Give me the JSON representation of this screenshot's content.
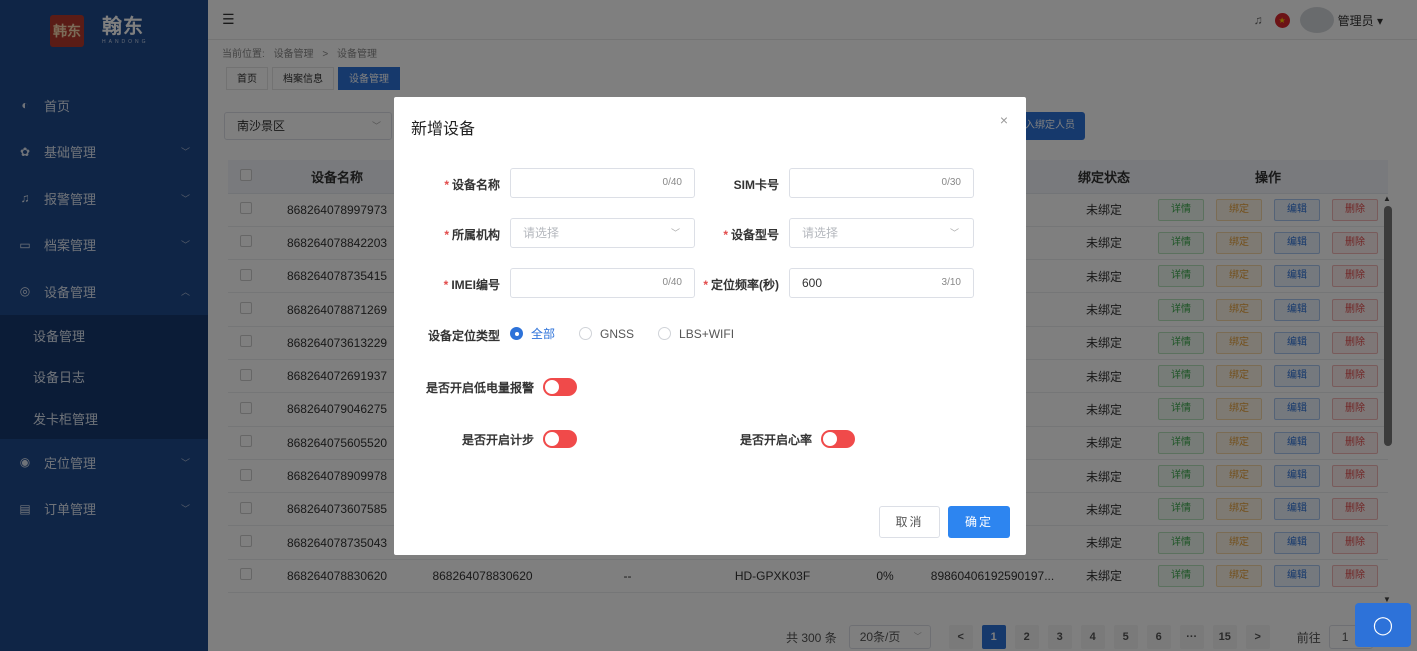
{
  "brand": {
    "logo_char": "韩东",
    "name": "翰东",
    "subtitle": "HANDONG"
  },
  "sidebar": {
    "items": [
      {
        "label": "首页",
        "icon": "dashboard-icon",
        "glyph": "◐",
        "chevron": ""
      },
      {
        "label": "基础管理",
        "icon": "gear-icon",
        "glyph": "✿",
        "chevron": "﹀"
      },
      {
        "label": "报警管理",
        "icon": "bell-icon",
        "glyph": "♫",
        "chevron": "﹀"
      },
      {
        "label": "档案管理",
        "icon": "folder-icon",
        "glyph": "▭",
        "chevron": "﹀"
      },
      {
        "label": "设备管理",
        "icon": "device-icon",
        "glyph": "◎",
        "chevron": "︿"
      }
    ],
    "subitems": [
      "设备管理",
      "设备日志",
      "发卡柜管理"
    ],
    "items_after": [
      {
        "label": "定位管理",
        "icon": "location-icon",
        "glyph": "◉",
        "chevron": "﹀"
      },
      {
        "label": "订单管理",
        "icon": "order-icon",
        "glyph": "▤",
        "chevron": "﹀"
      }
    ]
  },
  "header": {
    "menu_glyph": "☰",
    "bell_glyph": "🔔",
    "user": "管理员 ▾"
  },
  "breadcrumb": {
    "prefix": "当前位置:",
    "path1": "设备管理",
    "sep": ">",
    "path2": "设备管理"
  },
  "tabs": [
    "首页",
    "档案信息",
    "设备管理"
  ],
  "filter": {
    "value": "南沙景区",
    "bind_button": "入绑定人员"
  },
  "table": {
    "headers": {
      "name": "设备名称",
      "bind_status": "绑定状态",
      "ops": "操作"
    },
    "ops": {
      "detail": "详情",
      "bind": "绑定",
      "edit": "编辑",
      "del": "删除"
    },
    "rows": [
      {
        "name": "868264078997973",
        "ellipsis": "...",
        "status": "未绑定"
      },
      {
        "name": "868264078842203",
        "ellipsis": "...",
        "status": "未绑定"
      },
      {
        "name": "868264078735415",
        "ellipsis": "...",
        "status": "未绑定"
      },
      {
        "name": "868264078871269",
        "ellipsis": "...",
        "status": "未绑定"
      },
      {
        "name": "868264073613229",
        "ellipsis": "...",
        "status": "未绑定"
      },
      {
        "name": "868264072691937",
        "ellipsis": "...",
        "status": "未绑定"
      },
      {
        "name": "868264079046275",
        "ellipsis": "...",
        "status": "未绑定"
      },
      {
        "name": "868264075605520",
        "ellipsis": "...",
        "status": "未绑定"
      },
      {
        "name": "868264078909978",
        "ellipsis": "...",
        "status": "未绑定"
      },
      {
        "name": "868264073607585",
        "ellipsis": "...",
        "status": "未绑定"
      },
      {
        "name": "868264078735043",
        "ellipsis": "...",
        "status": "未绑定"
      }
    ],
    "last_row": {
      "name": "868264078830620",
      "imei": "868264078830620",
      "org": "--",
      "model": "HD-GPXK03F",
      "battery": "0%",
      "sim": "89860406192590197...",
      "status": "未绑定"
    }
  },
  "pagination": {
    "total": "共 300 条",
    "size": "20条/页",
    "pages": [
      "1",
      "2",
      "3",
      "4",
      "5",
      "6",
      "···",
      "15"
    ],
    "current": "1",
    "goto": "前往",
    "goto_value": "1",
    "prev": "<",
    "next": ">"
  },
  "dialog": {
    "title": "新增设备",
    "close": "×",
    "device_name": {
      "label": "设备名称",
      "required": "*",
      "value": "",
      "count": "0/40"
    },
    "sim": {
      "label": "SIM卡号",
      "value": "",
      "count": "0/30"
    },
    "org": {
      "label": "所属机构",
      "required": "*",
      "placeholder": "请选择"
    },
    "model": {
      "label": "设备型号",
      "required": "*",
      "placeholder": "请选择"
    },
    "imei": {
      "label": "IMEI编号",
      "required": "*",
      "value": "",
      "count": "0/40"
    },
    "freq": {
      "label": "定位频率(秒)",
      "required": "*",
      "value": "600",
      "count": "3/10"
    },
    "loc_type": {
      "label": "设备定位类型",
      "options": [
        "全部",
        "GNSS",
        "LBS+WIFI"
      ],
      "selected": "全部"
    },
    "low_battery": {
      "label": "是否开启低电量报警",
      "on": false
    },
    "step": {
      "label": "是否开启计步",
      "on": false
    },
    "heart": {
      "label": "是否开启心率",
      "on": false
    },
    "cancel": "取消",
    "ok": "确定"
  },
  "colors": {
    "sidebar": "#1f4a8c",
    "primary": "#2d72d9",
    "danger": "#f04a4a"
  }
}
